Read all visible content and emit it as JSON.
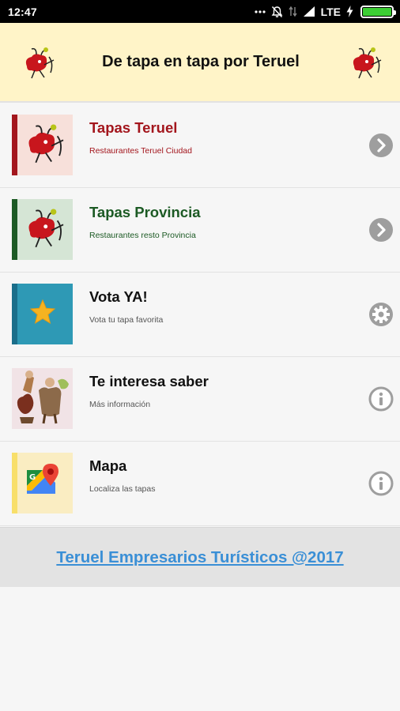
{
  "status_bar": {
    "time": "12:47",
    "network": "LTE",
    "icons": [
      "more-dots-icon",
      "mute-icon",
      "data-arrows-icon",
      "signal-icon",
      "charging-icon",
      "battery-icon"
    ]
  },
  "header": {
    "title": "De tapa en tapa por Teruel",
    "logo_icon": "bull-mascot-icon"
  },
  "items": [
    {
      "title": "Tapas Teruel",
      "subtitle": "Restaurantes Teruel Ciudad",
      "title_color": "#a3161d",
      "subtitle_color": "#a3161d",
      "bar_color": "#a3161d",
      "thumb_bg": "#f7e0da",
      "thumb_icon": "bull-mascot-icon",
      "action_icon": "chevron-right-icon"
    },
    {
      "title": "Tapas Provincia",
      "subtitle": "Restaurantes resto Provincia",
      "title_color": "#1c5a24",
      "subtitle_color": "#1c5a24",
      "bar_color": "#1c5a24",
      "thumb_bg": "#d5e5d5",
      "thumb_icon": "bull-mascot-icon",
      "action_icon": "chevron-right-icon"
    },
    {
      "title": "Vota YA!",
      "subtitle": "Vota tu tapa favorita",
      "title_color": "#111111",
      "subtitle_color": "#444444",
      "bar_color": "#1a6e8a",
      "thumb_bg": "#2e99b5",
      "thumb_icon": "star-icon",
      "action_icon": "gear-icon"
    },
    {
      "title": "Te interesa saber",
      "subtitle": "Más información",
      "title_color": "#111111",
      "subtitle_color": "#444444",
      "bar_color": "",
      "thumb_bg": "#f1e3e6",
      "thumb_icon": "lovers-illustration-icon",
      "action_icon": "info-icon"
    },
    {
      "title": "Mapa",
      "subtitle": "Localiza las tapas",
      "title_color": "#111111",
      "subtitle_color": "#444444",
      "bar_color": "#f8df6a",
      "thumb_bg": "#faedc2",
      "thumb_icon": "google-maps-icon",
      "action_icon": "info-icon"
    }
  ],
  "footer": {
    "link_text": "Teruel Empresarios Turísticos @2017"
  }
}
